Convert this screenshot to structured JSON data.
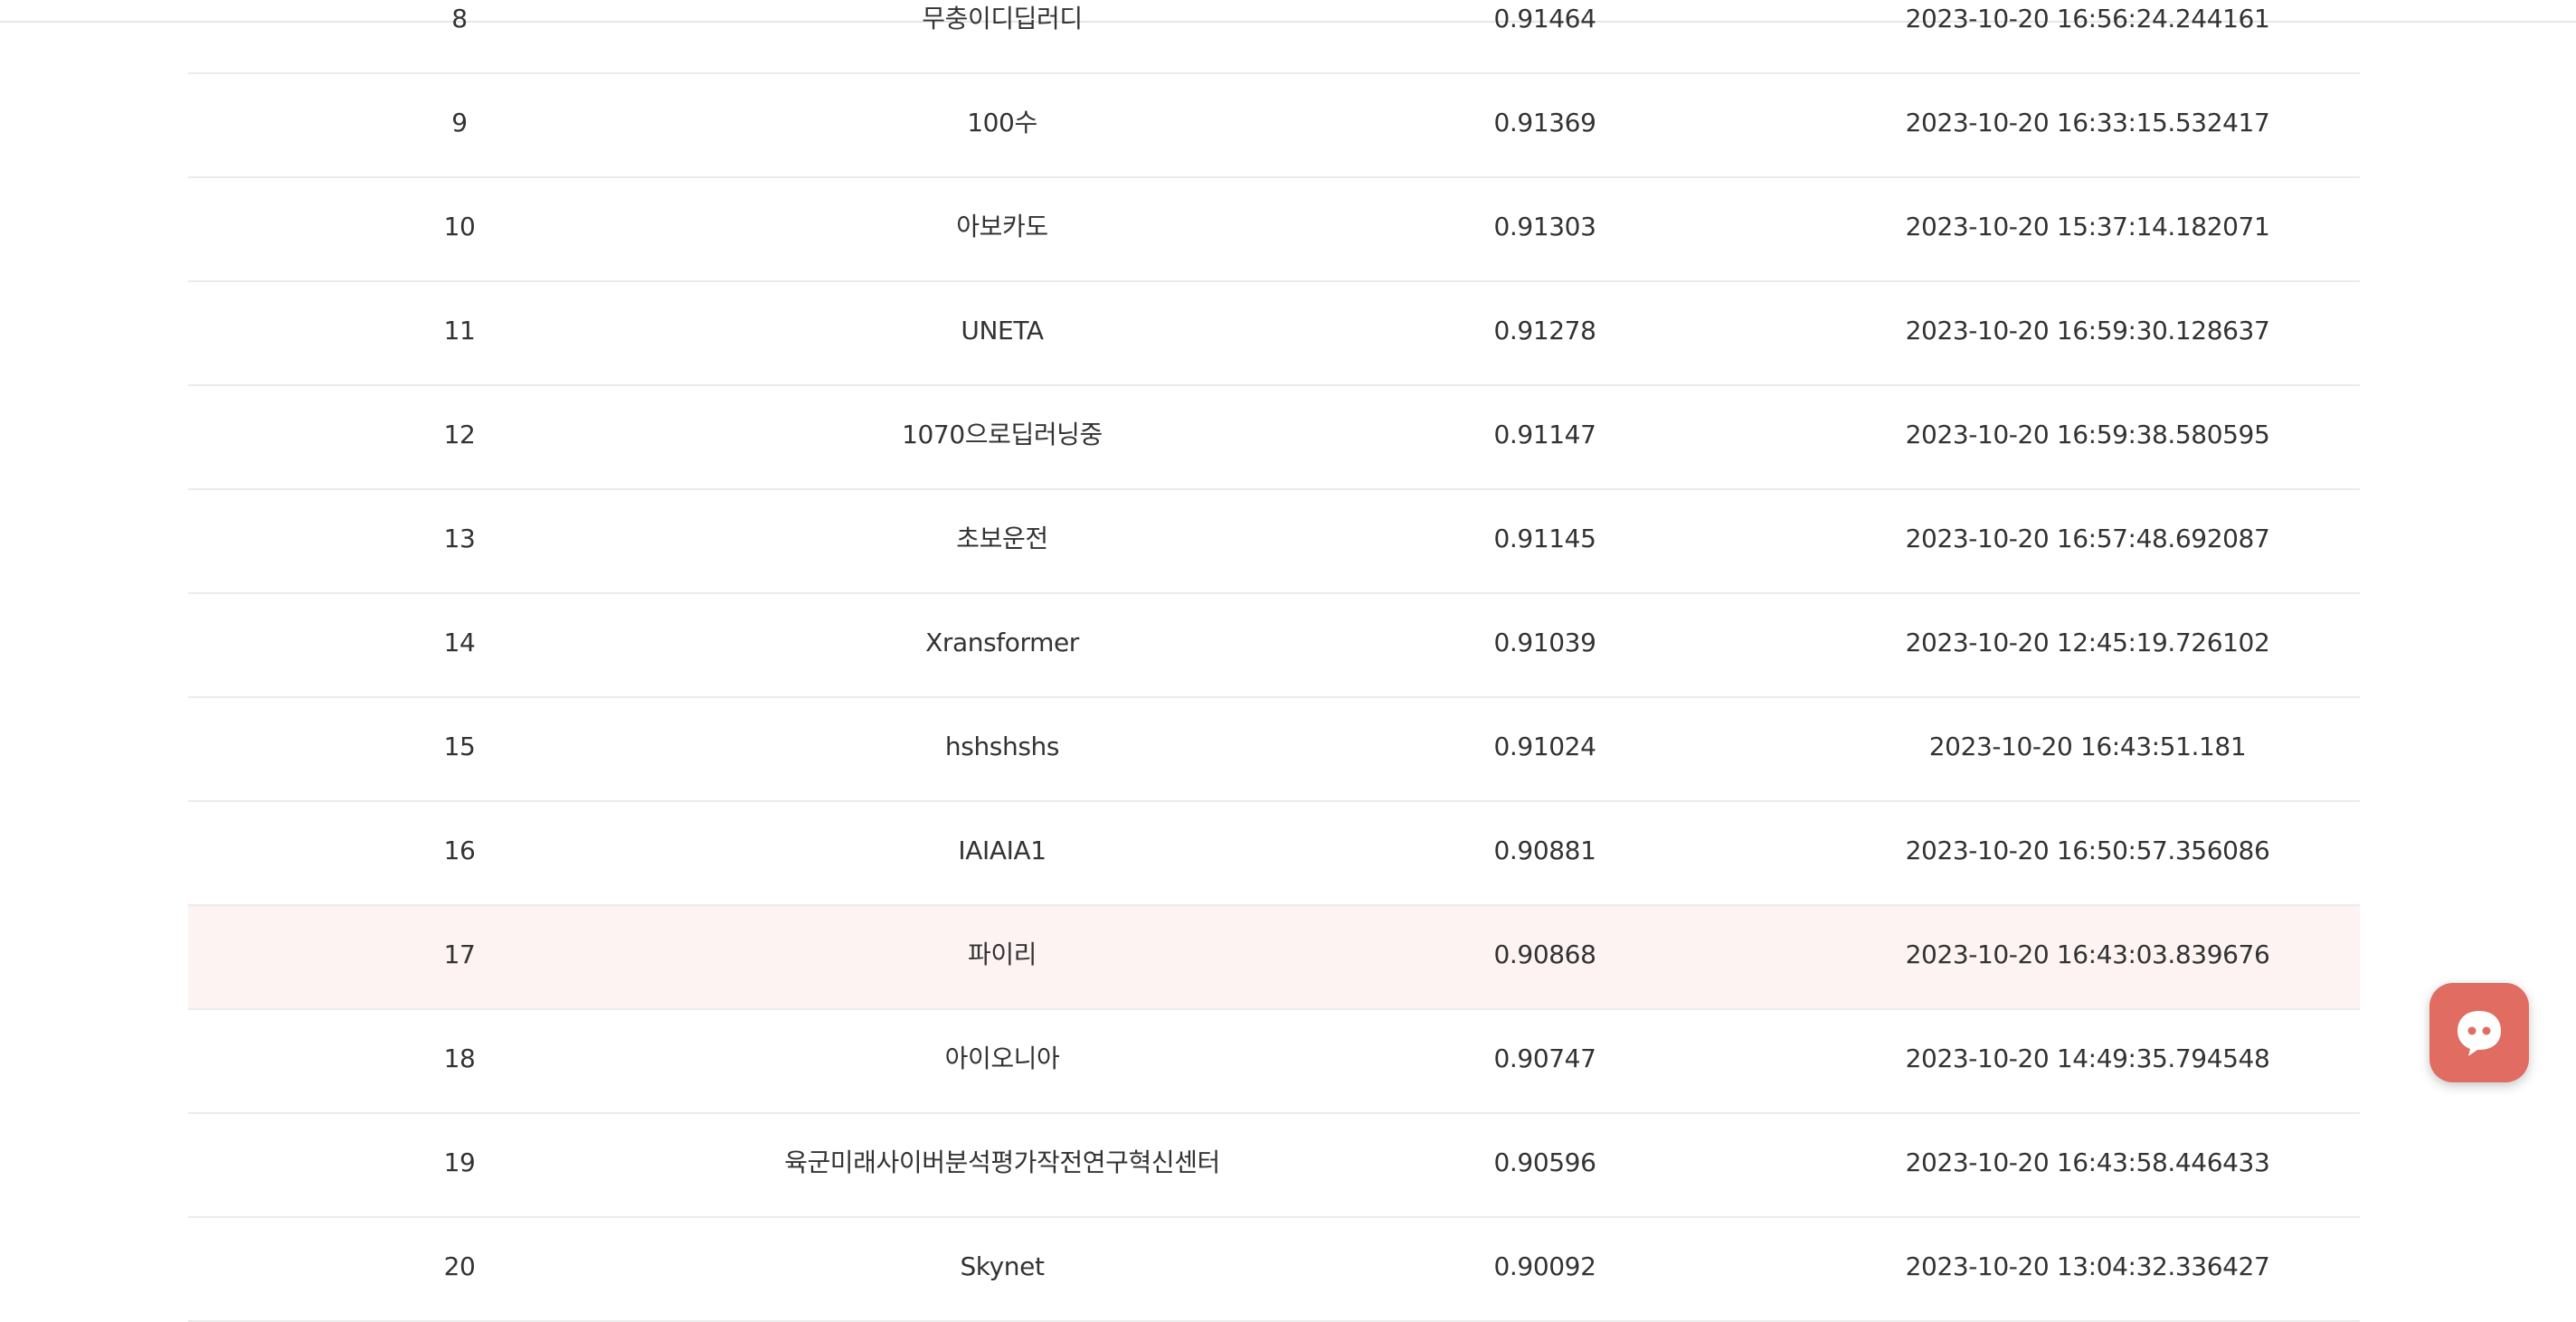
{
  "leaderboard": {
    "rows": [
      {
        "rank": "8",
        "team": "무충이디딥러디",
        "score": "0.91464",
        "submitted": "2023-10-20 16:56:24.244161",
        "highlighted": false
      },
      {
        "rank": "9",
        "team": "100수",
        "score": "0.91369",
        "submitted": "2023-10-20 16:33:15.532417",
        "highlighted": false
      },
      {
        "rank": "10",
        "team": "아보카도",
        "score": "0.91303",
        "submitted": "2023-10-20 15:37:14.182071",
        "highlighted": false
      },
      {
        "rank": "11",
        "team": "UNETA",
        "score": "0.91278",
        "submitted": "2023-10-20 16:59:30.128637",
        "highlighted": false
      },
      {
        "rank": "12",
        "team": "1070으로딥러닝중",
        "score": "0.91147",
        "submitted": "2023-10-20 16:59:38.580595",
        "highlighted": false
      },
      {
        "rank": "13",
        "team": "초보운전",
        "score": "0.91145",
        "submitted": "2023-10-20 16:57:48.692087",
        "highlighted": false
      },
      {
        "rank": "14",
        "team": "Xransformer",
        "score": "0.91039",
        "submitted": "2023-10-20 12:45:19.726102",
        "highlighted": false
      },
      {
        "rank": "15",
        "team": "hshshshs",
        "score": "0.91024",
        "submitted": "2023-10-20 16:43:51.181",
        "highlighted": false
      },
      {
        "rank": "16",
        "team": "IAIAIA1",
        "score": "0.90881",
        "submitted": "2023-10-20 16:50:57.356086",
        "highlighted": false
      },
      {
        "rank": "17",
        "team": "파이리",
        "score": "0.90868",
        "submitted": "2023-10-20 16:43:03.839676",
        "highlighted": true
      },
      {
        "rank": "18",
        "team": "아이오니아",
        "score": "0.90747",
        "submitted": "2023-10-20 14:49:35.794548",
        "highlighted": false
      },
      {
        "rank": "19",
        "team": "육군미래사이버분석평가작전연구혁신센터",
        "score": "0.90596",
        "submitted": "2023-10-20 16:43:58.446433",
        "highlighted": false
      },
      {
        "rank": "20",
        "team": "Skynet",
        "score": "0.90092",
        "submitted": "2023-10-20 13:04:32.336427",
        "highlighted": false
      }
    ]
  },
  "colors": {
    "highlight_row": "#fdf3f2",
    "chat_button": "#e06c62",
    "row_divider": "#ebebeb"
  },
  "chat_button": {
    "icon": "chat-bubble-icon"
  }
}
